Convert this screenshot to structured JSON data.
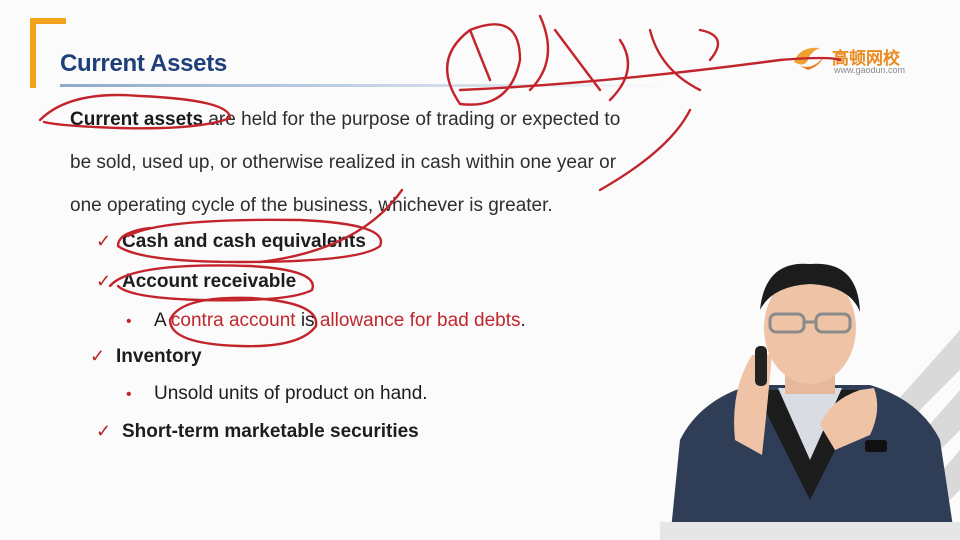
{
  "slide": {
    "title": "Current Assets",
    "logo": {
      "name": "高顿网校",
      "url": "www.gaodun.com"
    },
    "intro": {
      "term": "Current assets",
      "line1_rest": " are held for the purpose of trading or expected to",
      "line2": "be sold, used up, or otherwise realized in cash within one year or",
      "line3": "one operating cycle of the business, whichever is greater."
    },
    "items": [
      {
        "label": "Cash and cash equivalents"
      },
      {
        "label": "Account receivable"
      },
      {
        "label": "Inventory"
      },
      {
        "label": "Short-term marketable securities"
      }
    ],
    "subitems": {
      "receivable": {
        "prefix": "A ",
        "contra": "contra account",
        "mid": " is ",
        "allowance": "allowance for bad debts",
        "end": "."
      },
      "inventory": {
        "text": "Unsold units of product on hand."
      }
    }
  },
  "colors": {
    "title": "#1f3f7a",
    "accent": "#f2a31c",
    "check": "#b42525",
    "highlight": "#c0272d",
    "ink": "#c3242b"
  }
}
